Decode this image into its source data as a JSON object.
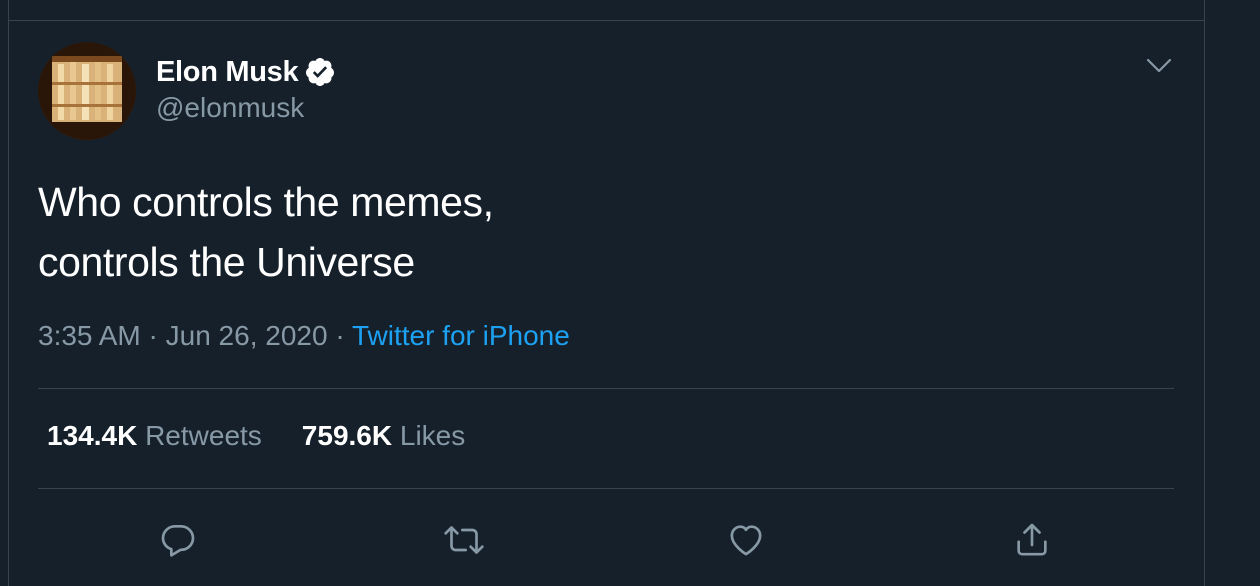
{
  "tweet": {
    "author": {
      "display_name": "Elon Musk",
      "handle": "@elonmusk",
      "verified": true
    },
    "text_lines": [
      "Who controls the memes,",
      "controls the Universe"
    ],
    "time": "3:35 AM",
    "separator": "·",
    "date": "Jun 26, 2020",
    "source": "Twitter for iPhone"
  },
  "stats": {
    "retweets_count": "134.4K",
    "retweets_label": "Retweets",
    "likes_count": "759.6K",
    "likes_label": "Likes"
  },
  "actions": {
    "icons": [
      "reply-icon",
      "retweet-icon",
      "like-icon",
      "share-icon"
    ]
  },
  "colors": {
    "background": "#15202b",
    "border": "#38444d",
    "muted_text": "#8899a6",
    "link": "#1da1f2",
    "verified": "#ffffff"
  }
}
